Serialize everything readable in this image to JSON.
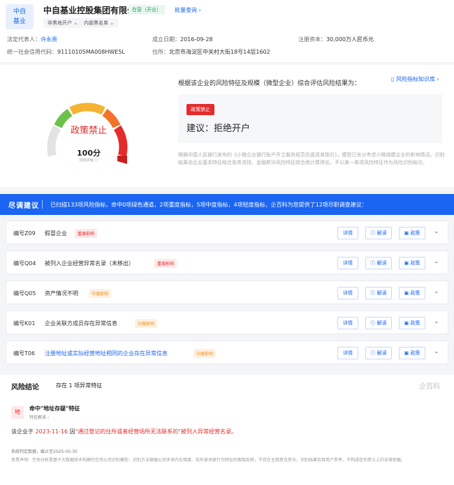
{
  "company": {
    "logo_line1": "中自",
    "logo_line2": "基业",
    "name": "中自基业控股集团有限公司",
    "status": "在营（开业）",
    "batch_query": "批量查询 ›",
    "tag1": "非黑地开户 ⌄",
    "tag2": "内部黑名单 ⌄",
    "legal_rep_label": "法定代表人：",
    "legal_rep": "许永贵",
    "founded_label": "成立日期：",
    "founded": "2016-09-28",
    "capital_label": "注册资本：",
    "capital": "30,000万人民币元",
    "credit_code_label": "统一社会信用代码：",
    "credit_code": "91110105MA008HWE5L",
    "address_label": "住所：",
    "address": "北京市海淀区中关村大街18号14层1602"
  },
  "risk": {
    "gauge_text": "政策禁止",
    "score": "100分",
    "score_sub": "风险评级 ⓘ",
    "description": "根据该企业的风险特征及规模（微型企业）综合评估风险结果为：",
    "knowledge": "▯ 风险指标知识库 ›",
    "policy_tag": "政策禁止",
    "advice": "建议：拒绝开户",
    "basis": "根据中国人民银行发布的《小微企业银行账户开立服务规范负面清单指引》，模型已充分考虑小微规模企业的影响情况，识别结果由企业基本特征结合各类洗钱、金融欺诈风险特征综合统计算得出，不以某一单项风险特征作为风险识别结论。"
  },
  "bar": {
    "title": "尽调建议",
    "text": "已扫描133项风险指标，命中0项绿色通道，2项重度指标，5项中度指标，4项轻度指标，企百科为您提供了12项尽职调查建议："
  },
  "buttons": {
    "detail": "详情",
    "interpret": "ⓘ 解读",
    "policy": "▣ 政策",
    "chevron": "⌄"
  },
  "items": [
    {
      "code": "编号Z09",
      "title": "假冒企业",
      "level": "重度影响"
    },
    {
      "code": "编号Q04",
      "title": "被列入企业经营异常名录（未移出）",
      "level": "重度影响"
    },
    {
      "code": "编号Q05",
      "title": "资产情况不明",
      "level": "中度影响"
    },
    {
      "code": "编号K01",
      "title": "企业关联方成员存在异常信息",
      "level": "中度影响"
    },
    {
      "code": "编号T06",
      "title": "注册地址或实际经营地址相同的企业存在异常信息",
      "level": "中度影响"
    }
  ],
  "conclusion": {
    "heading": "风险结论",
    "subheading": "存在 1 项异常特征",
    "brand": "企百科",
    "icon": "地",
    "feature_title": "命中\"地址存疑\"特征",
    "feature_sub": "特征解读 ›",
    "text_prefix": "该企业于",
    "date": "2023-11-16",
    "text_mid": "因",
    "reason": "\"通过登记的住所或者经营场所无法联系的\"被列入异常经营名录。",
    "sys": "系统判定数据，截止至2025-05-30",
    "disclaimer": "免责声明：空壳分析是基于大数据技术构建的空壳公司识别模型，识别方法根据公司多项内在维度、及外部关联行为特征的客观反映，不存在主观意见参与，识别结果仅供用户参考，不构成任何意义上的法律依据。"
  },
  "colors": {
    "accent": "#1a65f1",
    "danger": "#e42b2b",
    "warning": "#f28c1f"
  }
}
